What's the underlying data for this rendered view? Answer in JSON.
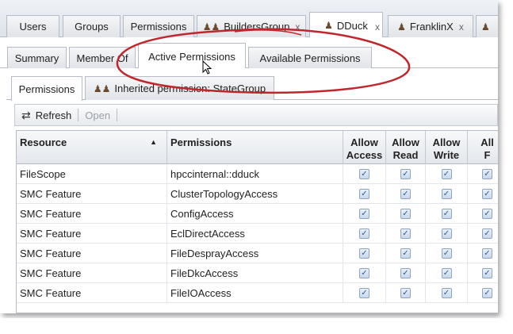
{
  "top_tabs": [
    {
      "label": "Users",
      "icon": "",
      "closable": false,
      "active": false
    },
    {
      "label": "Groups",
      "icon": "",
      "closable": false,
      "active": false
    },
    {
      "label": "Permissions",
      "icon": "",
      "closable": false,
      "active": false
    },
    {
      "label": "BuildersGroup",
      "icon": "group-icon",
      "closable": true,
      "active": false
    },
    {
      "label": "DDuck",
      "icon": "user-icon",
      "closable": true,
      "active": true
    },
    {
      "label": "FranklinX",
      "icon": "user-icon",
      "closable": true,
      "active": false
    }
  ],
  "close_glyph": "x",
  "sub_tabs": [
    {
      "label": "Summary",
      "active": false
    },
    {
      "label": "Member Of",
      "active": false
    },
    {
      "label": "Active Permissions",
      "active": true
    },
    {
      "label": "Available Permissions",
      "active": false
    }
  ],
  "inner_tabs": [
    {
      "label": "Permissions",
      "icon": "",
      "active": true
    },
    {
      "label": "Inherited permission: StateGroup",
      "icon": "group-icon",
      "active": false
    }
  ],
  "toolbar": {
    "refresh_label": "Refresh",
    "refresh_icon": "refresh-icon",
    "open_label": "Open"
  },
  "grid": {
    "columns": [
      {
        "label": "Resource",
        "sort": "ascending"
      },
      {
        "label": "Permissions"
      },
      {
        "line1": "Allow",
        "line2": "Access"
      },
      {
        "line1": "Allow",
        "line2": "Read"
      },
      {
        "line1": "Allow",
        "line2": "Write"
      },
      {
        "line1": "All",
        "line2": "F"
      }
    ],
    "rows": [
      {
        "resource": "FileScope",
        "permission": "hpccinternal::dduck",
        "access": true,
        "read": true,
        "write": true,
        "full": true
      },
      {
        "resource": "SMC Feature",
        "permission": "ClusterTopologyAccess",
        "access": true,
        "read": true,
        "write": true,
        "full": true
      },
      {
        "resource": "SMC Feature",
        "permission": "ConfigAccess",
        "access": true,
        "read": true,
        "write": true,
        "full": true
      },
      {
        "resource": "SMC Feature",
        "permission": "EclDirectAccess",
        "access": true,
        "read": true,
        "write": true,
        "full": true
      },
      {
        "resource": "SMC Feature",
        "permission": "FileDesprayAccess",
        "access": true,
        "read": true,
        "write": true,
        "full": true
      },
      {
        "resource": "SMC Feature",
        "permission": "FileDkcAccess",
        "access": true,
        "read": true,
        "write": true,
        "full": true
      },
      {
        "resource": "SMC Feature",
        "permission": "FileIOAccess",
        "access": true,
        "read": true,
        "write": true,
        "full": true
      }
    ]
  },
  "colors": {
    "annotation_ellipse": "#c0272d",
    "checkbox_border": "#8fa4bd",
    "tab_border": "#b5bcc7"
  }
}
